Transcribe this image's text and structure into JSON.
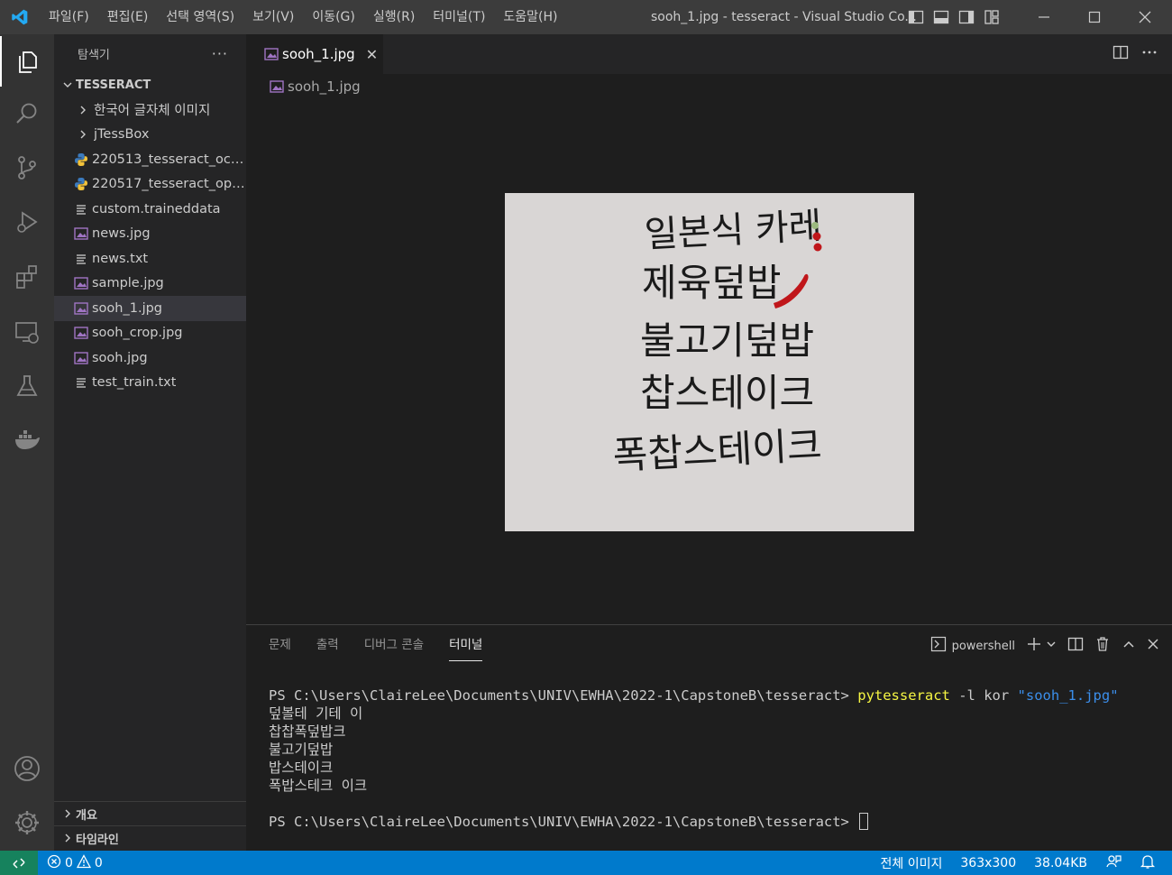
{
  "menubar": {
    "items": [
      "파일(F)",
      "편집(E)",
      "선택 영역(S)",
      "보기(V)",
      "이동(G)",
      "실행(R)",
      "터미널(T)",
      "도움말(H)"
    ]
  },
  "window": {
    "title": "sooh_1.jpg - tesseract - Visual Studio Co..."
  },
  "sidebar": {
    "title": "탐색기",
    "more": "···",
    "project": "TESSERACT",
    "items": [
      {
        "label": "한국어 글자체 이미지",
        "type": "folder"
      },
      {
        "label": "jTessBox",
        "type": "folder"
      },
      {
        "label": "220513_tesseract_ocr....",
        "type": "python"
      },
      {
        "label": "220517_tesseract_ope...",
        "type": "python"
      },
      {
        "label": "custom.traineddata",
        "type": "text"
      },
      {
        "label": "news.jpg",
        "type": "image"
      },
      {
        "label": "news.txt",
        "type": "text"
      },
      {
        "label": "sample.jpg",
        "type": "image"
      },
      {
        "label": "sooh_1.jpg",
        "type": "image",
        "selected": true
      },
      {
        "label": "sooh_crop.jpg",
        "type": "image"
      },
      {
        "label": "sooh.jpg",
        "type": "image"
      },
      {
        "label": "test_train.txt",
        "type": "text"
      }
    ],
    "outline": "개요",
    "timeline": "타임라인"
  },
  "editor": {
    "tab_label": "sooh_1.jpg",
    "close_glyph": "✕",
    "breadcrumb": "sooh_1.jpg",
    "image_lines": [
      "일본식 카레",
      "제육덮밥",
      "불고기덮밥",
      "찹스테이크",
      "폭찹스테이크"
    ]
  },
  "panel": {
    "tabs": [
      "문제",
      "출력",
      "디버그 콘솔",
      "터미널"
    ],
    "active_tab": "터미널",
    "shell": "powershell",
    "terminal": {
      "prompt": "PS C:\\Users\\ClaireLee\\Documents\\UNIV\\EWHA\\2022-1\\CapstoneB\\tesseract> ",
      "command": "pytesseract",
      "args": " -l kor ",
      "arg_string": "\"sooh_1.jpg\"",
      "output": [
        "덮볼테 기테 이",
        "찹찹폭덮밥크",
        "불고기덮밥",
        "밥스테이크",
        "폭밥스테크 이크"
      ]
    }
  },
  "statusbar": {
    "errors": "0",
    "warnings": "0",
    "image_scope": "전체 이미지",
    "dimensions": "363x300",
    "filesize": "38.04KB"
  },
  "colors": {
    "titlebar": "#3c3c3c",
    "activitybar": "#333333",
    "sidebar": "#252526",
    "editor": "#1e1e1e",
    "statusbar": "#007acc",
    "remote": "#16825d",
    "vscode_blue": "#23a9f2",
    "chili_red": "#c0161a"
  }
}
